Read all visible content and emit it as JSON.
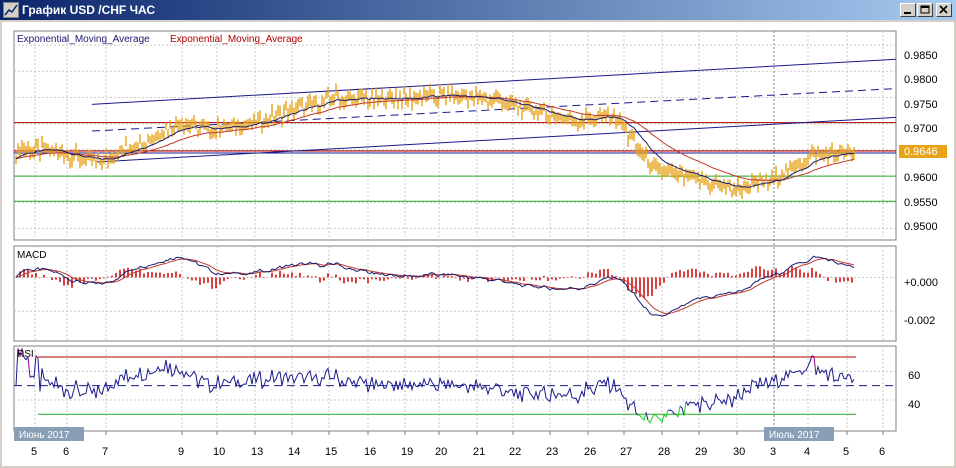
{
  "window": {
    "title": "График USD /CHF ЧАС",
    "buttons": [
      "minimize",
      "maximize",
      "close"
    ]
  },
  "colors": {
    "price": "#e8a317",
    "ema_fast": "#1a1a6e",
    "ema_slow": "#c0392b",
    "trend_blue": "#1a1a8c",
    "resistance_red": "#b00000",
    "support_green": "#22aa22",
    "macd_hist": "#cc0000",
    "rsi_line": "#1a1a8c",
    "rsi_over": "#8b008b",
    "rsi_under": "#22cc22",
    "grid": "#c8c8c8"
  },
  "main_panel": {
    "legend": [
      "Exponential_Moving_Average",
      "Exponential_Moving_Average"
    ],
    "y_ticks": [
      "0.9850",
      "0.9800",
      "0.9750",
      "0.9700",
      "0.9650",
      "0.9600",
      "0.9550",
      "0.9500"
    ],
    "current_price": "0.9646"
  },
  "macd_panel": {
    "label": "MACD",
    "y_ticks": [
      "+0.000",
      "-0.002"
    ]
  },
  "rsi_panel": {
    "label": "RSI",
    "y_ticks": [
      "60",
      "40"
    ]
  },
  "x_axis": {
    "month_badge_left": "Июнь 2017",
    "month_badge_right": "Июль 2017",
    "days": [
      "5",
      "6",
      "7",
      "9",
      "10",
      "13",
      "14",
      "15",
      "16",
      "19",
      "20",
      "21",
      "22",
      "23",
      "26",
      "27",
      "28",
      "29",
      "30",
      "3",
      "4",
      "5",
      "6"
    ]
  },
  "chart_data": {
    "type": "line",
    "title": "График USD /CHF ЧАС",
    "series": [
      {
        "name": "Exponential_Moving_Average"
      },
      {
        "name": "Exponential_Moving_Average"
      }
    ],
    "x": [
      "5",
      "6",
      "7",
      "9",
      "10",
      "13",
      "14",
      "15",
      "16",
      "19",
      "20",
      "21",
      "22",
      "23",
      "26",
      "27",
      "28",
      "29",
      "30",
      "3",
      "4",
      "5"
    ],
    "price_close": [
      0.965,
      0.9648,
      0.9625,
      0.966,
      0.97,
      0.969,
      0.97,
      0.9725,
      0.975,
      0.9745,
      0.975,
      0.9755,
      0.9745,
      0.9725,
      0.9705,
      0.9715,
      0.961,
      0.9595,
      0.9575,
      0.9595,
      0.964,
      0.9646
    ],
    "ylim": [
      0.948,
      0.9875
    ],
    "y_ticks": [
      0.985,
      0.98,
      0.975,
      0.97,
      0.965,
      0.96,
      0.955,
      0.95
    ],
    "horizontal_levels": {
      "resistance": 0.9702,
      "current": 0.9648,
      "support_upper": 0.96,
      "support_lower": 0.9552
    },
    "macd_ylim": [
      -0.0037,
      0.0018
    ],
    "rsi_ylim": [
      19,
      77
    ],
    "rsi_levels": [
      70,
      50,
      30
    ],
    "rsi_ticks": [
      60,
      40
    ]
  }
}
